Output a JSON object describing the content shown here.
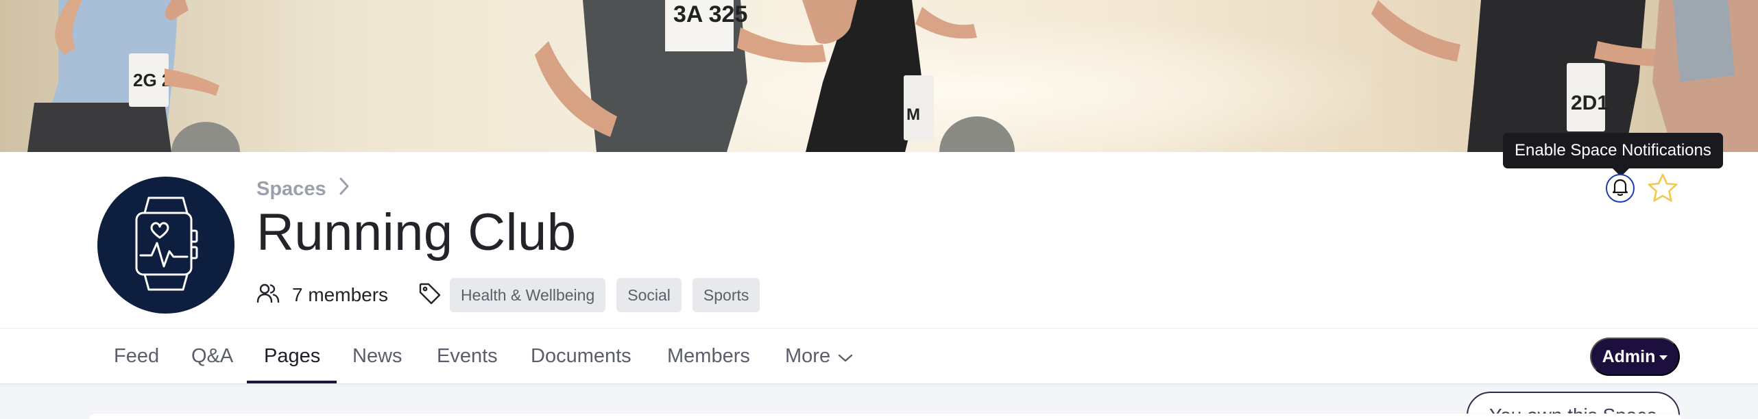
{
  "space": {
    "breadcrumb_label": "Spaces",
    "title": "Running Club",
    "members_count": "7 members",
    "tags": [
      "Health & Wellbeing",
      "Social",
      "Sports"
    ],
    "avatar_icon": "smartwatch-heart-icon"
  },
  "header_actions": {
    "tooltip": "Enable Space Notifications",
    "bell_icon": "bell-icon",
    "star_icon": "star-icon",
    "own_label": "You own this Space"
  },
  "nav": {
    "tabs": [
      "Feed",
      "Q&A",
      "Pages",
      "News",
      "Events",
      "Documents",
      "Members",
      "More"
    ],
    "active_tab": "Pages",
    "admin_label": "Admin"
  },
  "colors": {
    "brand_dark": "#1c0f3d",
    "avatar_bg": "#0e1e3f",
    "star": "#f2c94c",
    "bell_ring": "#1f3bb3"
  }
}
